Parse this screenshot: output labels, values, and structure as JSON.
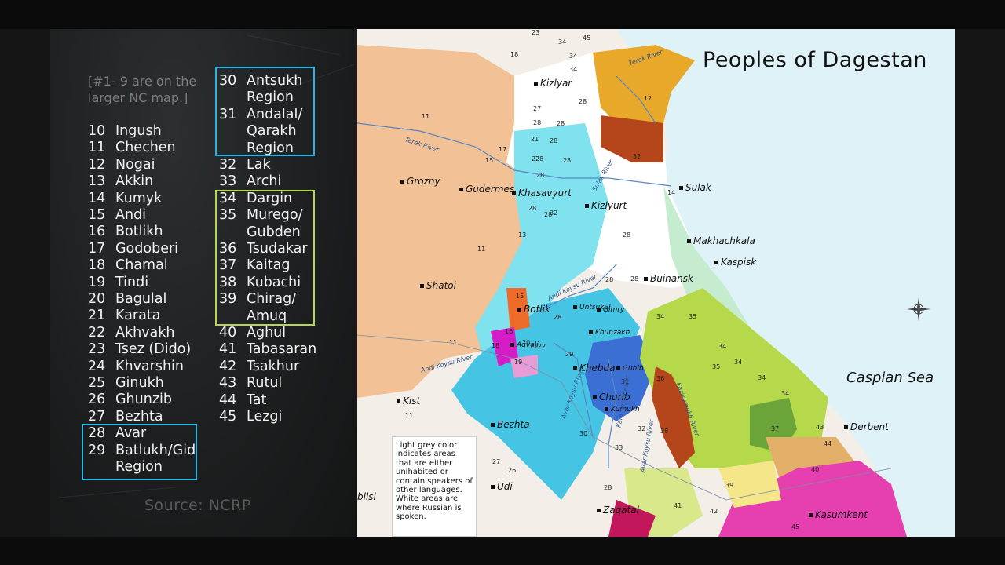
{
  "title": "Peoples of Dagestan",
  "note": "[#1- 9 are on the larger NC map.]",
  "source": "Source: NCRP",
  "legend_left": [
    {
      "num": "10",
      "name": "Ingush"
    },
    {
      "num": "11",
      "name": "Chechen"
    },
    {
      "num": "12",
      "name": "Nogai"
    },
    {
      "num": "13",
      "name": "Akkin"
    },
    {
      "num": "14",
      "name": "Kumyk"
    },
    {
      "num": "15",
      "name": "Andi"
    },
    {
      "num": "16",
      "name": "Botlikh"
    },
    {
      "num": "17",
      "name": "Godoberi"
    },
    {
      "num": "18",
      "name": "Chamal"
    },
    {
      "num": "19",
      "name": "Tindi"
    },
    {
      "num": "20",
      "name": "Bagulal"
    },
    {
      "num": "21",
      "name": "Karata"
    },
    {
      "num": "22",
      "name": "Akhvakh"
    },
    {
      "num": "23",
      "name": "Tsez (Dido)"
    },
    {
      "num": "24",
      "name": "Khvarshin"
    },
    {
      "num": "25",
      "name": "Ginukh"
    },
    {
      "num": "26",
      "name": "Ghunzib"
    },
    {
      "num": "27",
      "name": "Bezhta"
    },
    {
      "num": "28",
      "name": "Avar"
    },
    {
      "num": "29",
      "name": "Batlukh/Gid",
      "cont": "Region"
    }
  ],
  "legend_right": [
    {
      "num": "30",
      "name": "Antsukh",
      "cont": "Region"
    },
    {
      "num": "31",
      "name": "Andalal/",
      "cont": "Qarakh",
      "cont2": "Region"
    },
    {
      "num": "32",
      "name": "Lak"
    },
    {
      "num": "33",
      "name": "Archi"
    },
    {
      "num": "34",
      "name": "Dargin"
    },
    {
      "num": "35",
      "name": "Murego/",
      "cont": "Gubden"
    },
    {
      "num": "36",
      "name": "Tsudakar"
    },
    {
      "num": "37",
      "name": "Kaitag"
    },
    {
      "num": "38",
      "name": "Kubachi"
    },
    {
      "num": "39",
      "name": "Chirag/",
      "cont": "Amuq"
    },
    {
      "num": "40",
      "name": "Aghul"
    },
    {
      "num": "41",
      "name": "Tabasaran"
    },
    {
      "num": "42",
      "name": "Tsakhur"
    },
    {
      "num": "43",
      "name": "Rutul"
    },
    {
      "num": "44",
      "name": "Tat"
    },
    {
      "num": "45",
      "name": "Lezgi"
    }
  ],
  "map_note": "Light grey color indicates areas that are either unihabited or contain speakers of other languages. White areas are where Russian is spoken.",
  "sea": "Caspian Sea",
  "cities": [
    "Grozny",
    "Gudermes",
    "Khasavyurt",
    "Kizlyurt",
    "Kizlyar",
    "Sulak",
    "Makhachkala",
    "Kaspisk",
    "Buinansk",
    "Shatoi",
    "Botlik",
    "Khebda",
    "Churib",
    "Bezhta",
    "Derbent",
    "Kasumkent",
    "Zaqatal",
    "Kist",
    "Udi",
    "blisi",
    "Untsukul",
    "Khunzakh",
    "Gunib",
    "Gimry",
    "Kumukh",
    "Agvali"
  ],
  "rivers": [
    "Terek River",
    "Terek River",
    "Sulak River",
    "Andi Koysu River",
    "Avar Koysu River",
    "Kazikumukh River",
    "Kara Koysu River",
    "Andi Koysu River",
    "Avar Koysu River"
  ],
  "compass": {
    "n": "N",
    "s": "S",
    "e": "E",
    "w": "W"
  },
  "group_colors": {
    "avar": "#29b6e0",
    "dargin": "#b5d94a"
  },
  "region_numbers": [
    "23",
    "34",
    "45",
    "18",
    "34",
    "34",
    "12",
    "28",
    "27",
    "28",
    "11",
    "28",
    "28",
    "28",
    "28",
    "32",
    "17",
    "21",
    "15",
    "28",
    "22",
    "14",
    "13",
    "32",
    "28",
    "28",
    "28",
    "28",
    "28",
    "11",
    "11",
    "15",
    "16",
    "18",
    "19",
    "20",
    "21",
    "22",
    "28",
    "29",
    "31",
    "30",
    "28",
    "32",
    "33",
    "34",
    "35",
    "36",
    "37",
    "38",
    "39",
    "40",
    "41",
    "42",
    "43",
    "44",
    "45",
    "11",
    "27",
    "26",
    "34",
    "34",
    "34",
    "34",
    "35"
  ]
}
